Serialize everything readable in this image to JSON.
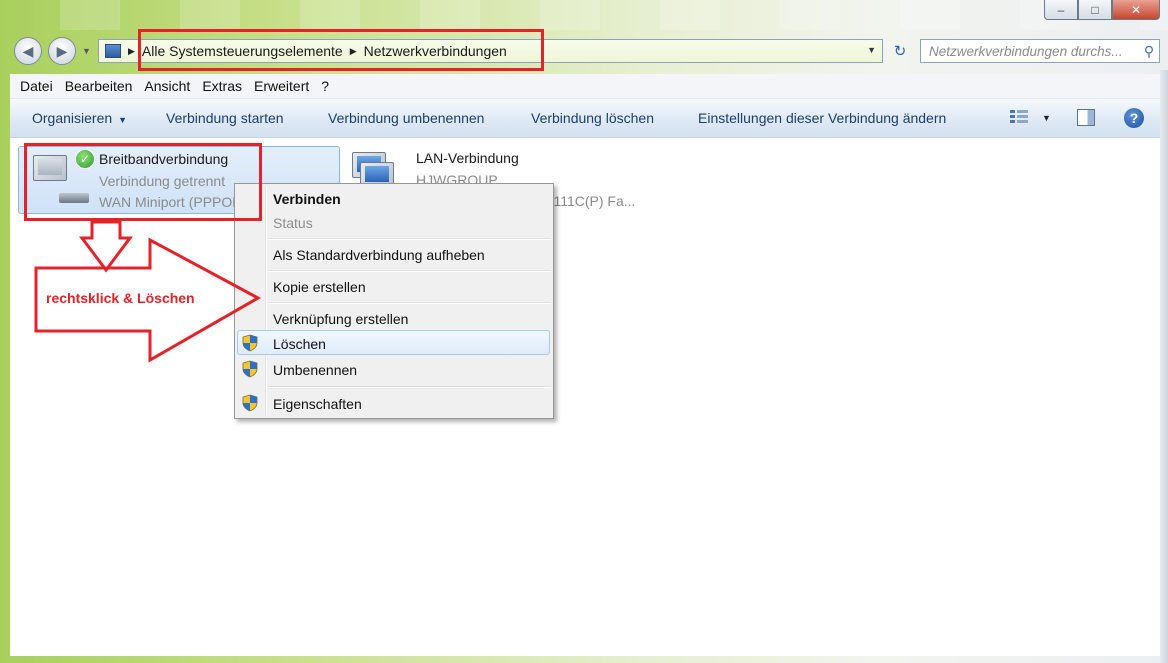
{
  "window": {
    "min": "–",
    "max": "□",
    "close": "✕"
  },
  "nav": {
    "breadcrumb": [
      "Alle Systemsteuerungselemente",
      "Netzwerkverbindungen"
    ],
    "search_placeholder": "Netzwerkverbindungen durchs..."
  },
  "menu": [
    "Datei",
    "Bearbeiten",
    "Ansicht",
    "Extras",
    "Erweitert",
    "?"
  ],
  "commands": {
    "organize": "Organisieren",
    "start": "Verbindung starten",
    "rename": "Verbindung umbenennen",
    "delete": "Verbindung löschen",
    "settings": "Einstellungen dieser Verbindung ändern"
  },
  "connections": [
    {
      "name": "Breitbandverbindung",
      "status": "Verbindung getrennt",
      "device": "WAN Miniport (PPPOE)"
    },
    {
      "name": "LAN-Verbindung",
      "status": "HJWGROUP",
      "device": "...8111C(P) Fa..."
    }
  ],
  "context_menu": {
    "connect": "Verbinden",
    "status": "Status",
    "unset_default": "Als Standardverbindung aufheben",
    "copy": "Kopie erstellen",
    "shortcut": "Verknüpfung erstellen",
    "delete": "Löschen",
    "rename": "Umbenennen",
    "properties": "Eigenschaften"
  },
  "annotation": {
    "text": "rechtsklick & Löschen",
    "color": "#e3222a"
  }
}
